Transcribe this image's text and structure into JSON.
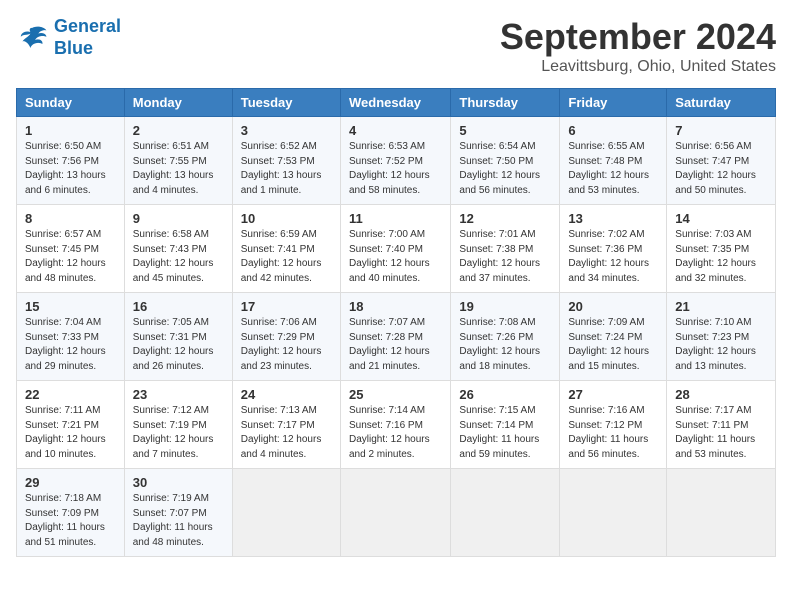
{
  "header": {
    "logo_line1": "General",
    "logo_line2": "Blue",
    "title": "September 2024",
    "subtitle": "Leavittsburg, Ohio, United States"
  },
  "weekdays": [
    "Sunday",
    "Monday",
    "Tuesday",
    "Wednesday",
    "Thursday",
    "Friday",
    "Saturday"
  ],
  "weeks": [
    [
      {
        "day": "1",
        "sunrise": "6:50 AM",
        "sunset": "7:56 PM",
        "daylight": "13 hours and 6 minutes."
      },
      {
        "day": "2",
        "sunrise": "6:51 AM",
        "sunset": "7:55 PM",
        "daylight": "13 hours and 4 minutes."
      },
      {
        "day": "3",
        "sunrise": "6:52 AM",
        "sunset": "7:53 PM",
        "daylight": "13 hours and 1 minute."
      },
      {
        "day": "4",
        "sunrise": "6:53 AM",
        "sunset": "7:52 PM",
        "daylight": "12 hours and 58 minutes."
      },
      {
        "day": "5",
        "sunrise": "6:54 AM",
        "sunset": "7:50 PM",
        "daylight": "12 hours and 56 minutes."
      },
      {
        "day": "6",
        "sunrise": "6:55 AM",
        "sunset": "7:48 PM",
        "daylight": "12 hours and 53 minutes."
      },
      {
        "day": "7",
        "sunrise": "6:56 AM",
        "sunset": "7:47 PM",
        "daylight": "12 hours and 50 minutes."
      }
    ],
    [
      {
        "day": "8",
        "sunrise": "6:57 AM",
        "sunset": "7:45 PM",
        "daylight": "12 hours and 48 minutes."
      },
      {
        "day": "9",
        "sunrise": "6:58 AM",
        "sunset": "7:43 PM",
        "daylight": "12 hours and 45 minutes."
      },
      {
        "day": "10",
        "sunrise": "6:59 AM",
        "sunset": "7:41 PM",
        "daylight": "12 hours and 42 minutes."
      },
      {
        "day": "11",
        "sunrise": "7:00 AM",
        "sunset": "7:40 PM",
        "daylight": "12 hours and 40 minutes."
      },
      {
        "day": "12",
        "sunrise": "7:01 AM",
        "sunset": "7:38 PM",
        "daylight": "12 hours and 37 minutes."
      },
      {
        "day": "13",
        "sunrise": "7:02 AM",
        "sunset": "7:36 PM",
        "daylight": "12 hours and 34 minutes."
      },
      {
        "day": "14",
        "sunrise": "7:03 AM",
        "sunset": "7:35 PM",
        "daylight": "12 hours and 32 minutes."
      }
    ],
    [
      {
        "day": "15",
        "sunrise": "7:04 AM",
        "sunset": "7:33 PM",
        "daylight": "12 hours and 29 minutes."
      },
      {
        "day": "16",
        "sunrise": "7:05 AM",
        "sunset": "7:31 PM",
        "daylight": "12 hours and 26 minutes."
      },
      {
        "day": "17",
        "sunrise": "7:06 AM",
        "sunset": "7:29 PM",
        "daylight": "12 hours and 23 minutes."
      },
      {
        "day": "18",
        "sunrise": "7:07 AM",
        "sunset": "7:28 PM",
        "daylight": "12 hours and 21 minutes."
      },
      {
        "day": "19",
        "sunrise": "7:08 AM",
        "sunset": "7:26 PM",
        "daylight": "12 hours and 18 minutes."
      },
      {
        "day": "20",
        "sunrise": "7:09 AM",
        "sunset": "7:24 PM",
        "daylight": "12 hours and 15 minutes."
      },
      {
        "day": "21",
        "sunrise": "7:10 AM",
        "sunset": "7:23 PM",
        "daylight": "12 hours and 13 minutes."
      }
    ],
    [
      {
        "day": "22",
        "sunrise": "7:11 AM",
        "sunset": "7:21 PM",
        "daylight": "12 hours and 10 minutes."
      },
      {
        "day": "23",
        "sunrise": "7:12 AM",
        "sunset": "7:19 PM",
        "daylight": "12 hours and 7 minutes."
      },
      {
        "day": "24",
        "sunrise": "7:13 AM",
        "sunset": "7:17 PM",
        "daylight": "12 hours and 4 minutes."
      },
      {
        "day": "25",
        "sunrise": "7:14 AM",
        "sunset": "7:16 PM",
        "daylight": "12 hours and 2 minutes."
      },
      {
        "day": "26",
        "sunrise": "7:15 AM",
        "sunset": "7:14 PM",
        "daylight": "11 hours and 59 minutes."
      },
      {
        "day": "27",
        "sunrise": "7:16 AM",
        "sunset": "7:12 PM",
        "daylight": "11 hours and 56 minutes."
      },
      {
        "day": "28",
        "sunrise": "7:17 AM",
        "sunset": "7:11 PM",
        "daylight": "11 hours and 53 minutes."
      }
    ],
    [
      {
        "day": "29",
        "sunrise": "7:18 AM",
        "sunset": "7:09 PM",
        "daylight": "11 hours and 51 minutes."
      },
      {
        "day": "30",
        "sunrise": "7:19 AM",
        "sunset": "7:07 PM",
        "daylight": "11 hours and 48 minutes."
      },
      null,
      null,
      null,
      null,
      null
    ]
  ]
}
